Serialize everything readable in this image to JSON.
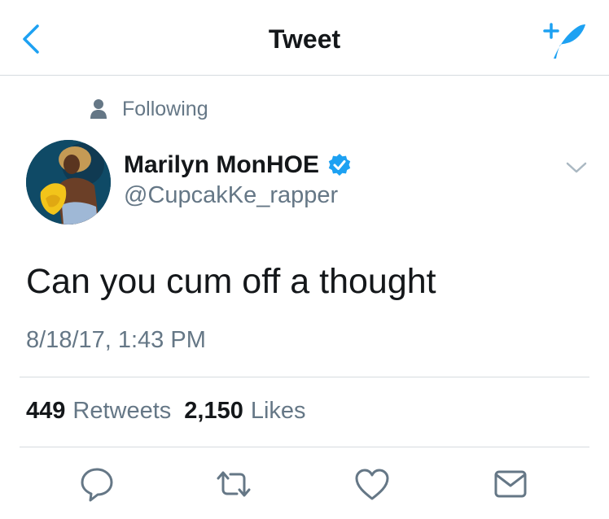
{
  "header": {
    "title": "Tweet"
  },
  "social_context": {
    "text": "Following",
    "icon": "person-icon"
  },
  "author": {
    "name": "Marilyn MonHOE",
    "handle": "@CupcakKe_rapper",
    "verified": true
  },
  "tweet": {
    "text": "Can you cum off a thought",
    "timestamp": "8/18/17, 1:43 PM"
  },
  "stats": {
    "retweets_count": "449",
    "retweets_label": "Retweets",
    "likes_count": "2,150",
    "likes_label": "Likes"
  },
  "actions": [
    "reply-icon",
    "retweet-icon",
    "like-icon",
    "direct-message-icon"
  ],
  "colors": {
    "accent": "#1da1f2",
    "text_primary": "#14171a",
    "text_secondary": "#657786",
    "icon_gray": "#657786",
    "divider": "#d6dbdf"
  }
}
